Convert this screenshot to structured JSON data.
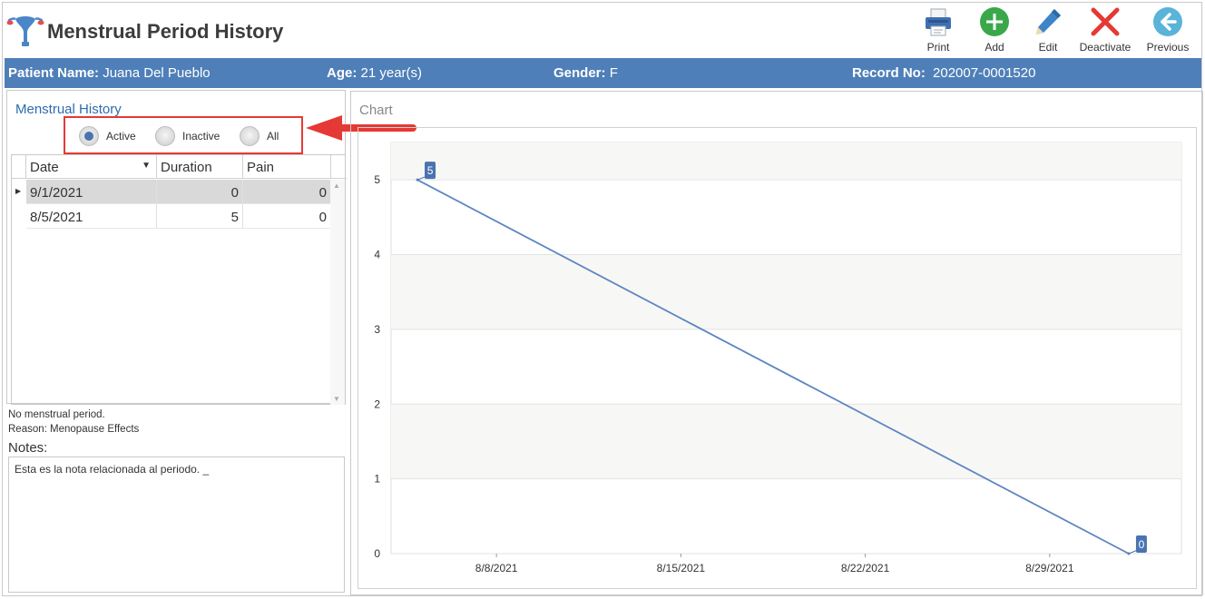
{
  "window": {
    "title": "Menstrual Period History"
  },
  "toolbar": {
    "buttons": [
      {
        "label": "Print",
        "icon": "printer-icon"
      },
      {
        "label": "Add",
        "icon": "plus-circle-icon"
      },
      {
        "label": "Edit",
        "icon": "pencil-icon"
      },
      {
        "label": "Deactivate",
        "icon": "red-x-icon"
      },
      {
        "label": "Previous",
        "icon": "arrow-left-circle-icon"
      }
    ]
  },
  "patient": {
    "name_label": "Patient Name:",
    "name": "Juana Del Pueblo",
    "age_label": "Age:",
    "age": "21 year(s)",
    "gender_label": "Gender:",
    "gender": "F",
    "record_label": "Record No:",
    "record": "202007-0001520"
  },
  "history": {
    "title": "Menstrual History",
    "filter": {
      "options": [
        "Active",
        "Inactive",
        "All"
      ],
      "selected": "Active"
    },
    "columns": [
      "Date",
      "Duration",
      "Pain"
    ],
    "rows": [
      {
        "date": "9/1/2021",
        "duration": "0",
        "pain": "0"
      },
      {
        "date": "8/5/2021",
        "duration": "5",
        "pain": "0"
      }
    ],
    "status_line": "No menstrual period.",
    "reason_line": "Reason: Menopause Effects",
    "notes_label": "Notes:",
    "notes_text": "Esta es la nota relacionada al periodo. _"
  },
  "chart_panel": {
    "title": "Chart"
  },
  "chart_data": {
    "type": "line",
    "title": "",
    "xlabel": "",
    "ylabel": "",
    "x": [
      "2021-08-05",
      "2021-09-01"
    ],
    "values": [
      5,
      0
    ],
    "data_labels": [
      "5",
      "0"
    ],
    "x_ticks": [
      "8/8/2021",
      "8/15/2021",
      "8/22/2021",
      "8/29/2021"
    ],
    "y_ticks": [
      "0",
      "1",
      "2",
      "3",
      "4",
      "5"
    ],
    "ylim": [
      0,
      5.5
    ],
    "xlim": [
      "2021-08-04",
      "2021-09-03"
    ],
    "grid": true,
    "legend": "none",
    "line_color": "#5b86c0",
    "label_color": "#4a73b0"
  },
  "colors": {
    "accent": "#4f7fb8",
    "highlight_border": "#e53935"
  }
}
